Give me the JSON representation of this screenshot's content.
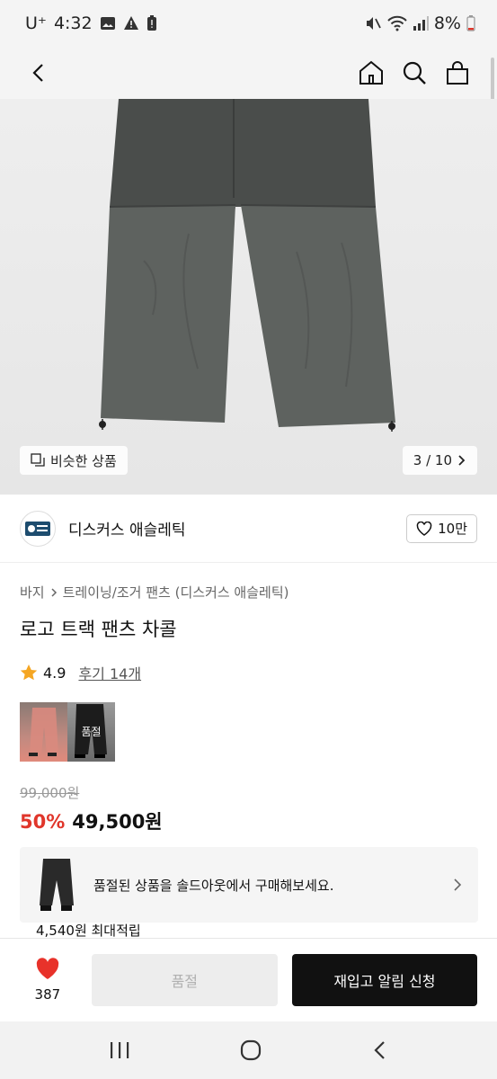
{
  "status_bar": {
    "carrier": "U⁺",
    "time": "4:32",
    "battery": "8%"
  },
  "nav": {
    "back": "back",
    "home": "home",
    "search": "search",
    "cart": "cart"
  },
  "gallery": {
    "similar_label": "비슷한 상품",
    "page_indicator": "3 / 10"
  },
  "brand": {
    "name": "디스커스 애슬레틱",
    "likes": "10만"
  },
  "product": {
    "breadcrumb": [
      "바지",
      "트레이닝/조거 팬츠 (디스커스 애슬레틱)"
    ],
    "title": "로고 트랙 팬츠 차콜",
    "rating": "4.9",
    "review_label": "후기 14개",
    "soldout_tag": "품절",
    "original_price": "99,000원",
    "discount": "50%",
    "sale_price": "49,500원",
    "soldout_banner": "품절된 상품을 솔드아웃에서 구매해보세요.",
    "points": "4,540원 최대적립"
  },
  "bottom": {
    "wish_count": "387",
    "soldout_button": "품절",
    "restock_button": "재입고 알림 신청"
  },
  "colors": {
    "accent_red": "#e0362b",
    "heart_red": "#e8322a",
    "star": "#f5a623"
  }
}
